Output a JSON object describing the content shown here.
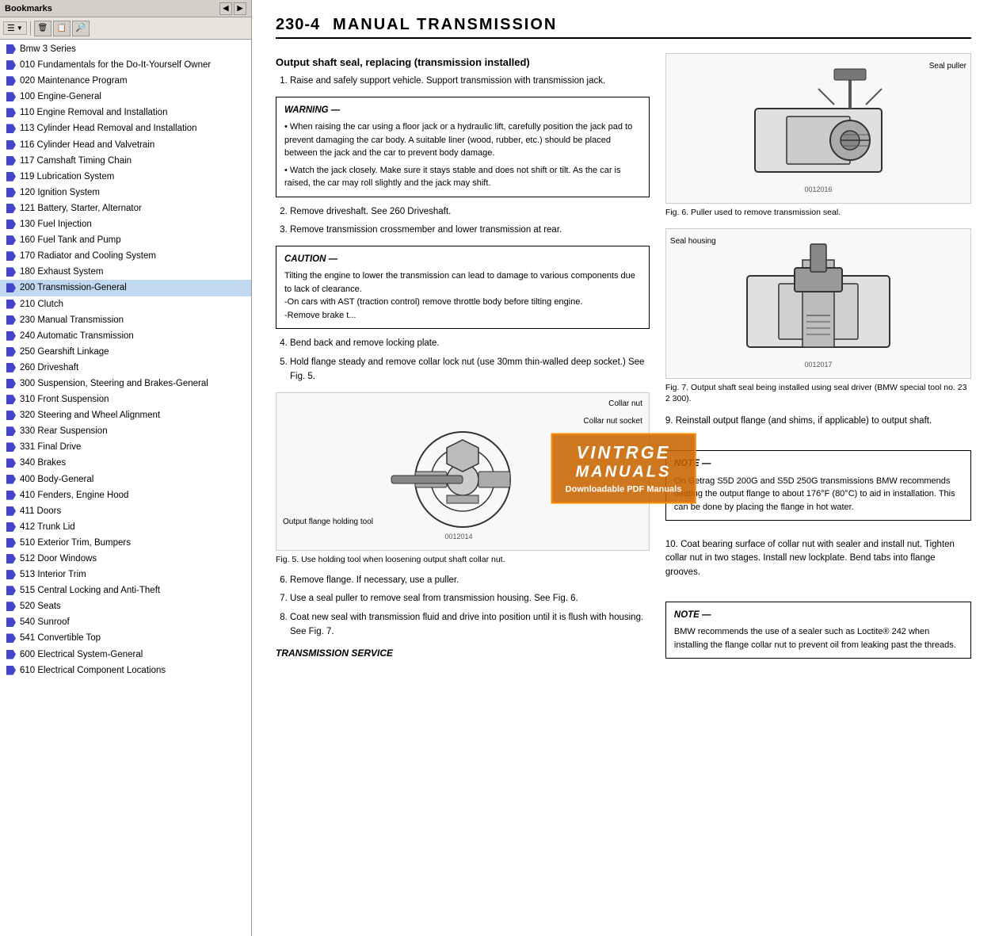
{
  "leftPanel": {
    "title": "Bookmarks",
    "items": [
      {
        "label": "Bmw 3 Series",
        "active": false
      },
      {
        "label": "010 Fundamentals for the Do-It-Yourself Owner",
        "active": false
      },
      {
        "label": "020 Maintenance Program",
        "active": false
      },
      {
        "label": "100 Engine-General",
        "active": false
      },
      {
        "label": "110 Engine Removal and Installation",
        "active": false
      },
      {
        "label": "113 Cylinder Head Removal and Installation",
        "active": false
      },
      {
        "label": "116 Cylinder Head and Valvetrain",
        "active": false
      },
      {
        "label": "117 Camshaft Timing Chain",
        "active": false
      },
      {
        "label": "119 Lubrication System",
        "active": false
      },
      {
        "label": "120 Ignition System",
        "active": false
      },
      {
        "label": "121 Battery, Starter, Alternator",
        "active": false
      },
      {
        "label": "130 Fuel Injection",
        "active": false
      },
      {
        "label": "160 Fuel Tank and Pump",
        "active": false
      },
      {
        "label": "170 Radiator and Cooling System",
        "active": false
      },
      {
        "label": "180 Exhaust System",
        "active": false
      },
      {
        "label": "200 Transmission-General",
        "active": true
      },
      {
        "label": "210 Clutch",
        "active": false
      },
      {
        "label": "230 Manual Transmission",
        "active": false
      },
      {
        "label": "240 Automatic Transmission",
        "active": false
      },
      {
        "label": "250 Gearshift Linkage",
        "active": false
      },
      {
        "label": "260 Driveshaft",
        "active": false
      },
      {
        "label": "300 Suspension, Steering and Brakes-General",
        "active": false
      },
      {
        "label": "310 Front Suspension",
        "active": false
      },
      {
        "label": "320 Steering and Wheel Alignment",
        "active": false
      },
      {
        "label": "330 Rear Suspension",
        "active": false
      },
      {
        "label": "331 Final Drive",
        "active": false
      },
      {
        "label": "340 Brakes",
        "active": false
      },
      {
        "label": "400 Body-General",
        "active": false
      },
      {
        "label": "410 Fenders, Engine Hood",
        "active": false
      },
      {
        "label": "411 Doors",
        "active": false
      },
      {
        "label": "412 Trunk Lid",
        "active": false
      },
      {
        "label": "510 Exterior Trim, Bumpers",
        "active": false
      },
      {
        "label": "512 Door Windows",
        "active": false
      },
      {
        "label": "513 Interior Trim",
        "active": false
      },
      {
        "label": "515 Central Locking and Anti-Theft",
        "active": false
      },
      {
        "label": "520 Seats",
        "active": false
      },
      {
        "label": "540 Sunroof",
        "active": false
      },
      {
        "label": "541 Convertible Top",
        "active": false
      },
      {
        "label": "600 Electrical System-General",
        "active": false
      },
      {
        "label": "610 Electrical Component Locations",
        "active": false
      }
    ]
  },
  "toolbar": {
    "delete_label": "🗑",
    "export_label": "📋",
    "options_label": "⚙"
  },
  "mainContent": {
    "pageNum": "230-4",
    "pageTitle": "Manual Transmission",
    "sectionHeading": "Output shaft seal, replacing (transmission installed)",
    "steps": [
      "Raise and safely support vehicle. Support transmission with transmission jack.",
      "Remove driveshaft. See 260 Driveshaft.",
      "Remove transmission crossmember and lower transmission at rear.",
      "Bend back and remove locking plate.",
      "Hold flange steady and remove collar lock nut (use 30mm thin-walled deep socket.) See Fig. 5.",
      "Remove flange. If necessary, use a puller.",
      "Use a seal puller to remove seal from transmission housing. See Fig. 6.",
      "Coat new seal with transmission fluid and drive into position until it is flush with housing. See Fig. 7."
    ],
    "steps2": [
      "9. Reinstall output flange (and shims, if applicable) to output shaft.",
      "10. Coat bearing surface of collar nut with sealer and install nut. Tighten collar nut in two stages. Install new lockplate. Bend tabs into flange grooves."
    ],
    "warningTitle": "WARNING —",
    "warningItems": [
      "When raising the car using a floor jack or a hydraulic lift, carefully position the jack pad to prevent damaging the car body. A suitable liner (wood, rubber, etc.) should be placed between the jack and the car to prevent body damage.",
      "Watch the jack closely. Make sure it stays stable and does not shift or tilt. As the car is raised, the car may roll slightly and the jack may shift."
    ],
    "cautionTitle": "CAUTION —",
    "cautionText": "Tilting the engine to lower the transmission can lead to damage to various components due to lack of clearance.\n-On cars with AST (traction control) remove throttle body before tilting engine.\n-Remove brake t...",
    "noteTitle1": "NOTE —",
    "noteText1": "On Getrag S5D 200G and S5D 250G transmissions BMW recommends heating the output flange to about 176°F (80°C) to aid in installation. This can be done by placing the flange in hot water.",
    "noteTitle2": "NOTE —",
    "noteText2": "BMW recommends the use of a sealer such as Loctite® 242 when installing the flange collar nut to prevent oil from leaking past the threads.",
    "fig5Caption": "Fig. 5.   Use holding tool when loosening output shaft collar nut.",
    "fig6Caption": "Fig. 6.   Puller used to remove transmission seal.",
    "fig7Caption": "Fig. 7.   Output shaft seal being installed using seal driver (BMW special tool no. 23 2 300).",
    "transmissionService": "TRANSMISSION SERVICE",
    "fig5Labels": {
      "collarNut": "Collar nut",
      "collarNutSocket": "Collar nut socket",
      "outputFlangeTool": "Output flange holding tool",
      "figNum": "0012014"
    },
    "fig6Labels": {
      "sealPuller": "Seal puller",
      "figNum": "0012016"
    },
    "fig7Labels": {
      "sealHousing": "Seal housing",
      "figNum": "0012017"
    },
    "watermark": {
      "line1": "VINTRGE",
      "line2": "MANUALS",
      "line3": "Downloadable PDF Manuals"
    }
  }
}
